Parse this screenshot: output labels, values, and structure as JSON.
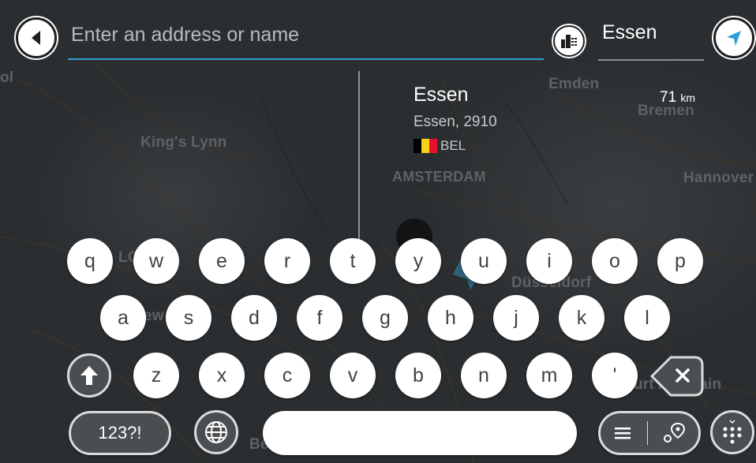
{
  "search": {
    "placeholder": "Enter an address or name"
  },
  "location_filter": {
    "value": "Essen"
  },
  "result": {
    "title": "Essen",
    "subtitle": "Essen, 2910",
    "country": "BEL",
    "distance_value": "71",
    "distance_unit": "km",
    "flag_colors": [
      "#000000",
      "#f6d21b",
      "#e8112d"
    ]
  },
  "map_labels": {
    "kings_lynn": "King's Lynn",
    "emden": "Emden",
    "bremen": "Bremen",
    "amsterdam": "AMSTERDAM",
    "hannover": "Hannover",
    "dusseldorf": "Düsseldorf",
    "lo": "LO",
    "ew": "ew",
    "ol": "ol",
    "frankfurt": "urt Am Main",
    "be": "Be"
  },
  "keyboard": {
    "row1": [
      "q",
      "w",
      "e",
      "r",
      "t",
      "y",
      "u",
      "i",
      "o",
      "p"
    ],
    "row2": [
      "a",
      "s",
      "d",
      "f",
      "g",
      "h",
      "j",
      "k",
      "l"
    ],
    "row3": [
      "z",
      "x",
      "c",
      "v",
      "b",
      "n",
      "m",
      "'"
    ],
    "numbers_label": "123?!"
  },
  "icons": {
    "back": "back-arrow-icon",
    "city": "city-icon",
    "navigate": "navigate-arrow-icon",
    "shift": "shift-arrow-icon",
    "backspace": "backspace-icon",
    "globe": "globe-icon",
    "list": "list-icon",
    "map_view": "map-view-icon",
    "keyboard_toggle": "keyboard-icon"
  },
  "colors": {
    "accent": "#2aa0d8",
    "background": "#2b2e30",
    "key": "#ffffff"
  }
}
